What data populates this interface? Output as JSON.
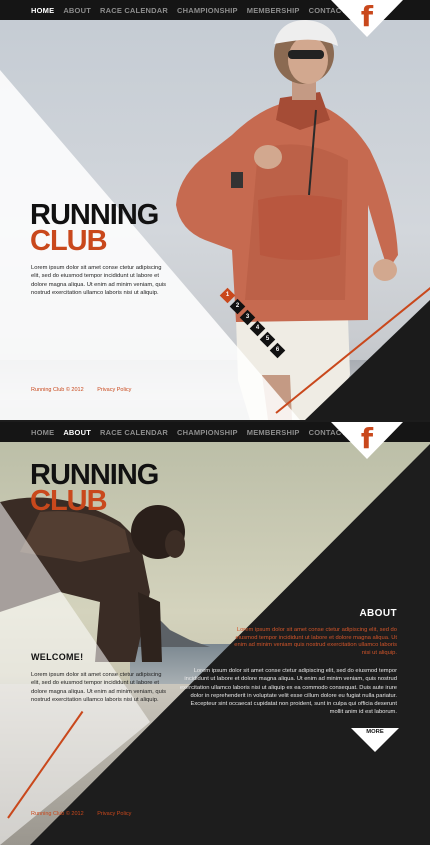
{
  "nav1": {
    "items": [
      "HOME",
      "ABOUT",
      "RACE CALENDAR",
      "CHAMPIONSHIP",
      "MEMBERSHIP",
      "CONTACTS"
    ],
    "active": "HOME"
  },
  "nav2": {
    "items": [
      "HOME",
      "ABOUT",
      "RACE CALENDAR",
      "CHAMPIONSHIP",
      "MEMBERSHIP",
      "CONTACTS"
    ],
    "active": "ABOUT"
  },
  "social": {
    "icon": "facebook-icon",
    "glyph": "f"
  },
  "brand": {
    "line1": "RUNNING",
    "line2": "CLUB"
  },
  "colors": {
    "accent": "#c9481c",
    "dark": "#1b1b1b",
    "white": "#ffffff"
  },
  "hero": {
    "text": "Lorem ipsum dolor sit amet conse ctetur adipiscing elit, sed do eiusmod tempor incididunt ut labore et dolore magna aliqua. Ut enim ad minim veniam, quis nostrud exercitation ullamco laboris nisi ut aliquip.",
    "pager": [
      "1",
      "2",
      "3",
      "4",
      "5",
      "6"
    ],
    "pager_active": "1"
  },
  "footer": {
    "copyright": "Running Club © 2012",
    "privacy": "Privacy Policy"
  },
  "about_page": {
    "welcome": "WELCOME!",
    "welcome_text": "Lorem ipsum dolor sit amet conse ctetur adipiscing elit, sed do eiusmod tempor incididunt ut labore et dolore magna aliqua. Ut enim ad minim veniam, quis nostrud exercitation ullamco laboris nisi ut aliquip.",
    "about_title": "ABOUT",
    "about_orange": "Lorem ipsum dolor sit amet conse ctetur adipiscing elit, sed do eiusmod tempor incididunt ut labore et dolore magna aliqua. Ut enim ad minim veniam quis nostrud exercitation ullamco laboris nisi ut aliquip.",
    "about_white": "Lorem ipsum dolor sit amet conse ctetur adipiscing elit, sed do eiusmod tempor incididunt ut labore et dolore magna aliqua. Ut enim ad minim veniam, quis nostrud exercitation ullamco laboris nisi ut aliquip ex ea commodo consequat. Duis aute irure dolor in reprehenderit in voluptate velit esse cillum dolore eu fugiat nulla pariatur. Excepteur sint occaecat cupidatat non proident, sunt in culpa qui officia deserunt mollit anim id est laborum.",
    "more": "MORE"
  }
}
